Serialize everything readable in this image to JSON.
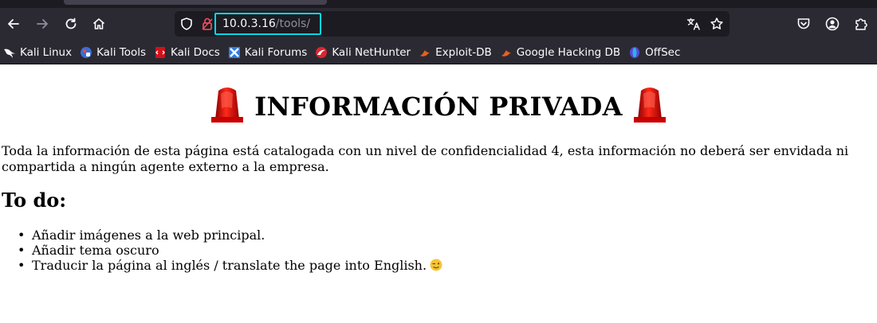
{
  "browser": {
    "url_host": "10.0.3.16",
    "url_path": "/tools/",
    "icons": {
      "back": "arrow-left-icon",
      "forward": "arrow-right-icon",
      "reload": "reload-icon",
      "home": "home-icon",
      "tracking": "shield-icon",
      "lock": "lock-icon",
      "translate": "translate-icon",
      "bookmark_star": "star-icon",
      "pocket": "pocket-icon",
      "account": "account-icon",
      "extensions": "extensions-icon"
    },
    "bookmarks": [
      {
        "label": "Kali Linux",
        "icon": "kali-dragon-icon"
      },
      {
        "label": "Kali Tools",
        "icon": "kali-tools-icon"
      },
      {
        "label": "Kali Docs",
        "icon": "kali-docs-icon"
      },
      {
        "label": "Kali Forums",
        "icon": "kali-forums-icon"
      },
      {
        "label": "Kali NetHunter",
        "icon": "nethunter-icon"
      },
      {
        "label": "Exploit-DB",
        "icon": "exploit-db-icon"
      },
      {
        "label": "Google Hacking DB",
        "icon": "ghdb-icon"
      },
      {
        "label": "OffSec",
        "icon": "offsec-icon"
      }
    ]
  },
  "page": {
    "title": "INFORMACIÓN PRIVADA",
    "intro": "Toda la información de esta página está catalogada con un nivel de confidencialidad 4, esta información no deberá ser envidada ni compartida a ningún agente externo a la empresa.",
    "todo_heading": "To do:",
    "todo_items": [
      "Añadir imágenes a la web principal.",
      "Añadir tema oscuro",
      "Traducir la página al inglés / translate the page into English."
    ],
    "icons": {
      "title_decoration": "siren-icon",
      "todo_emoji": "winking-face-icon"
    }
  },
  "colors": {
    "toolbar": "#2b2a33",
    "urlbar": "#1c1b22",
    "focus_ring": "#00d8e8",
    "siren_red": "#e00000"
  }
}
